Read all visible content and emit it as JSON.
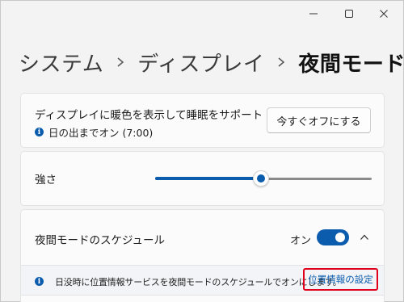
{
  "window": {
    "caption_buttons": [
      "minimize-icon",
      "maximize-icon",
      "close-icon"
    ]
  },
  "breadcrumb": {
    "items": [
      "システム",
      "ディスプレイ",
      "夜間モード"
    ],
    "separator_icon": "chevron-right-icon"
  },
  "night_light": {
    "title": "ディスプレイに暖色を表示して睡眠をサポート",
    "status": "日の出までオン (7:00)",
    "status_icon": "info-icon",
    "button_label": "今すぐオフにする"
  },
  "strength": {
    "label": "強さ",
    "value_fraction": 0.49
  },
  "schedule": {
    "label": "夜間モードのスケジュール",
    "toggle_label": "オン",
    "toggle_on": true,
    "expand_icon": "chevron-up-icon",
    "info_text": "日没時に位置情報サービスを夜間モードのスケジュールでオンにします。",
    "info_icon": "info-icon",
    "link_label": "位置情報の設定"
  },
  "colors": {
    "accent": "#0b5cad",
    "highlight_border": "#e0001b",
    "background": "#f3f3f3",
    "card": "#fbfbfb"
  }
}
